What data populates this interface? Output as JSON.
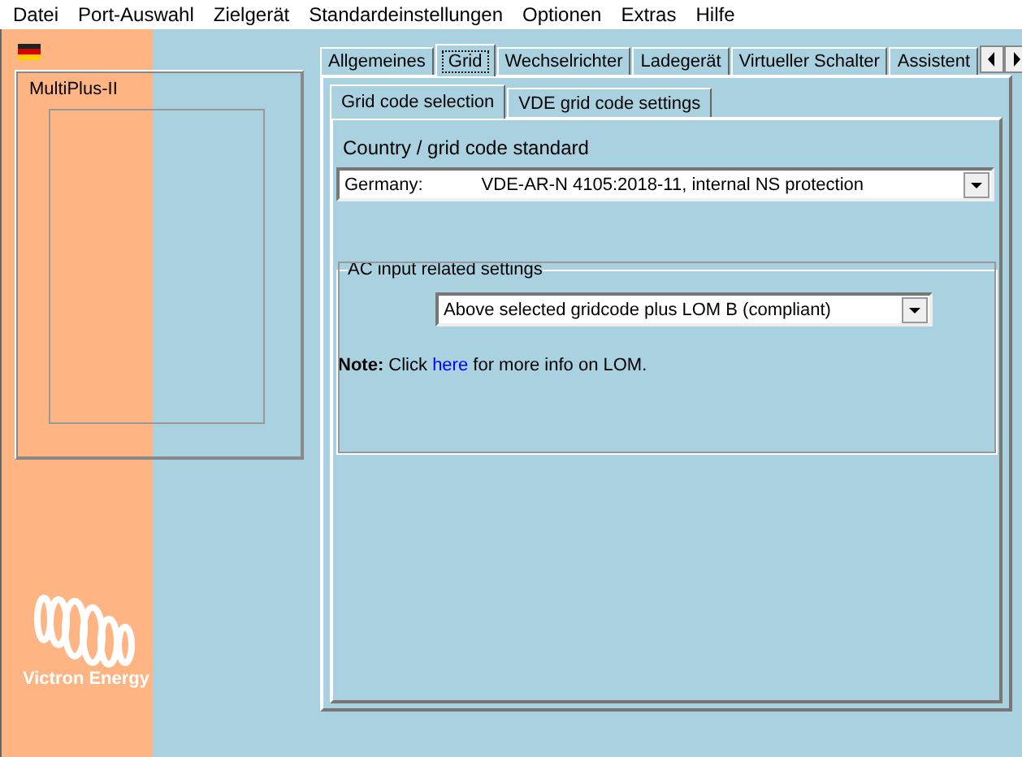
{
  "menu": [
    {
      "label": "Datei"
    },
    {
      "label": "Port-Auswahl"
    },
    {
      "label": "Zielgerät"
    },
    {
      "label": "Standardeinstellungen"
    },
    {
      "label": "Optionen"
    },
    {
      "label": "Extras"
    },
    {
      "label": "Hilfe"
    }
  ],
  "device_box": {
    "title": "MultiPlus-II"
  },
  "brand": "Victron Energy",
  "tabs": [
    {
      "label": "Allgemeines",
      "selected": false
    },
    {
      "label": "Grid",
      "selected": true
    },
    {
      "label": "Wechselrichter",
      "selected": false
    },
    {
      "label": "Ladegerät",
      "selected": false
    },
    {
      "label": "Virtueller Schalter",
      "selected": false
    },
    {
      "label": "Assistent",
      "selected": false
    }
  ],
  "subtabs": [
    {
      "label": "Grid code selection",
      "selected": true
    },
    {
      "label": "VDE grid code settings",
      "selected": false
    }
  ],
  "country": {
    "label": "Country / grid code standard",
    "country": "Germany:",
    "standard": "VDE-AR-N 4105:2018-11, internal NS protection"
  },
  "ac_input": {
    "title": "AC input related settings",
    "value": "Above selected gridcode plus LOM B (compliant)",
    "note_before": "**Note:** Click ",
    "note_link": "here",
    "note_after": " for more info on LOM."
  }
}
